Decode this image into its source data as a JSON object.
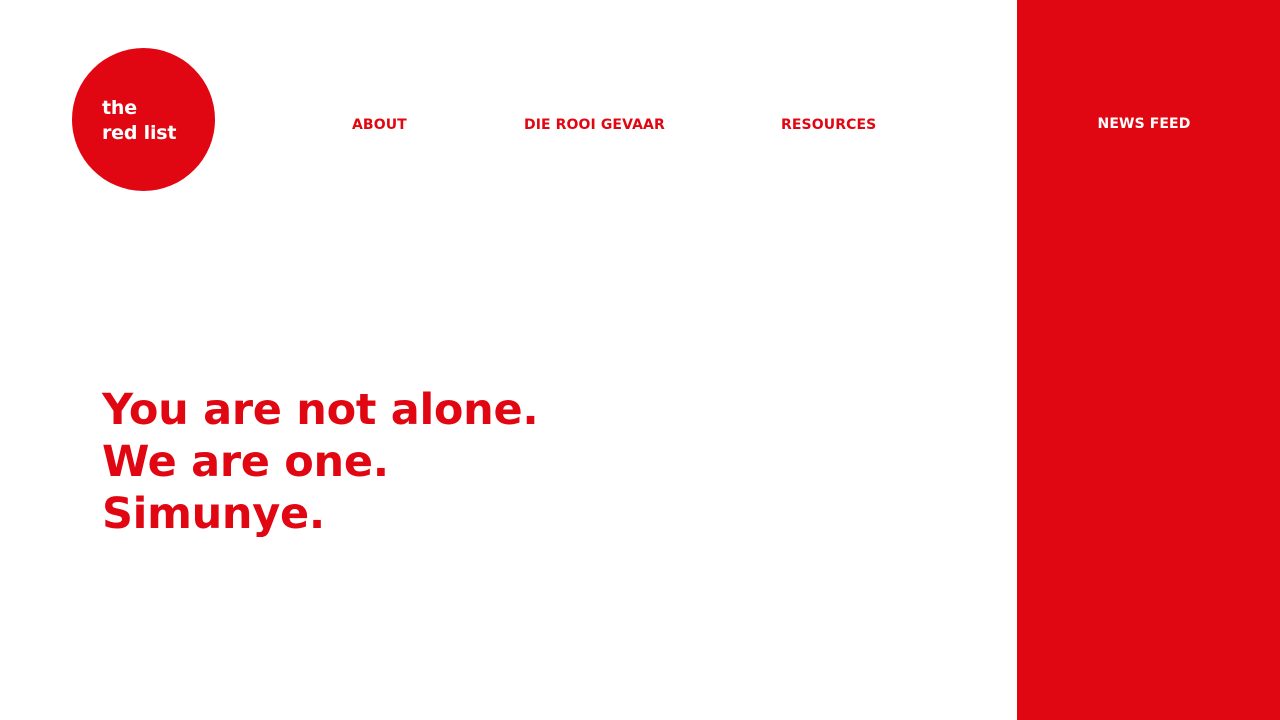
{
  "brand": {
    "logo_line1": "the",
    "logo_line2": "red list",
    "accent_color": "#e10712"
  },
  "nav": {
    "about": "ABOUT",
    "die_rooi_gevaar": "DIE ROOI GEVAAR",
    "resources": "RESOURCES",
    "news_feed": "NEWS FEED"
  },
  "hero": {
    "line1": "You are not alone.",
    "line2": "We are one.",
    "line3": "Simunye."
  }
}
